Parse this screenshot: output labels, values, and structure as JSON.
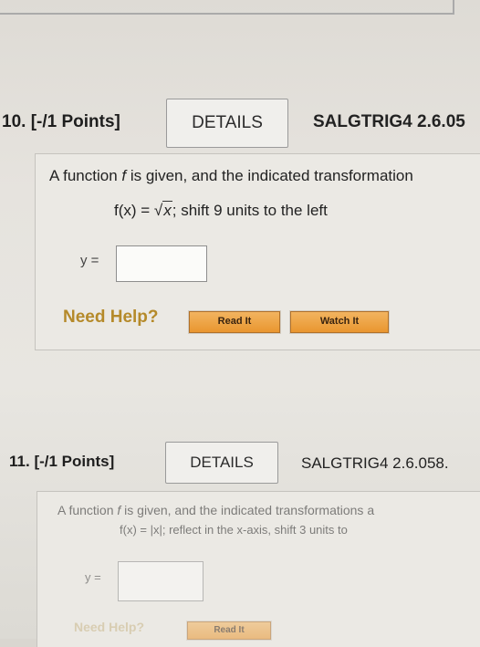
{
  "q10": {
    "number": "10.",
    "points": "[-/1 Points]",
    "details": "DETAILS",
    "code": "SALGTRIG4 2.6.05",
    "prompt_pre": "A function ",
    "prompt_f": "f",
    "prompt_post": " is given, and the indicated transformation",
    "func_lhs": "f(x) = ",
    "func_rad": "x",
    "func_rest": "; shift 9 units to the left",
    "y_label": "y =",
    "answer": "",
    "need_help": "Need Help?",
    "read_it": "Read It",
    "watch_it": "Watch It"
  },
  "q11": {
    "number": "11.",
    "points": "[-/1 Points]",
    "details": "DETAILS",
    "code": "SALGTRIG4 2.6.058.",
    "prompt_pre": "A function ",
    "prompt_f": "f",
    "prompt_post": " is given, and the indicated transformations a",
    "func_text": "f(x) = |x|; reflect in the x-axis, shift 3 units to",
    "y_label": "y =",
    "answer": "",
    "need_help": "Need Help?",
    "read_it": "Read It"
  }
}
